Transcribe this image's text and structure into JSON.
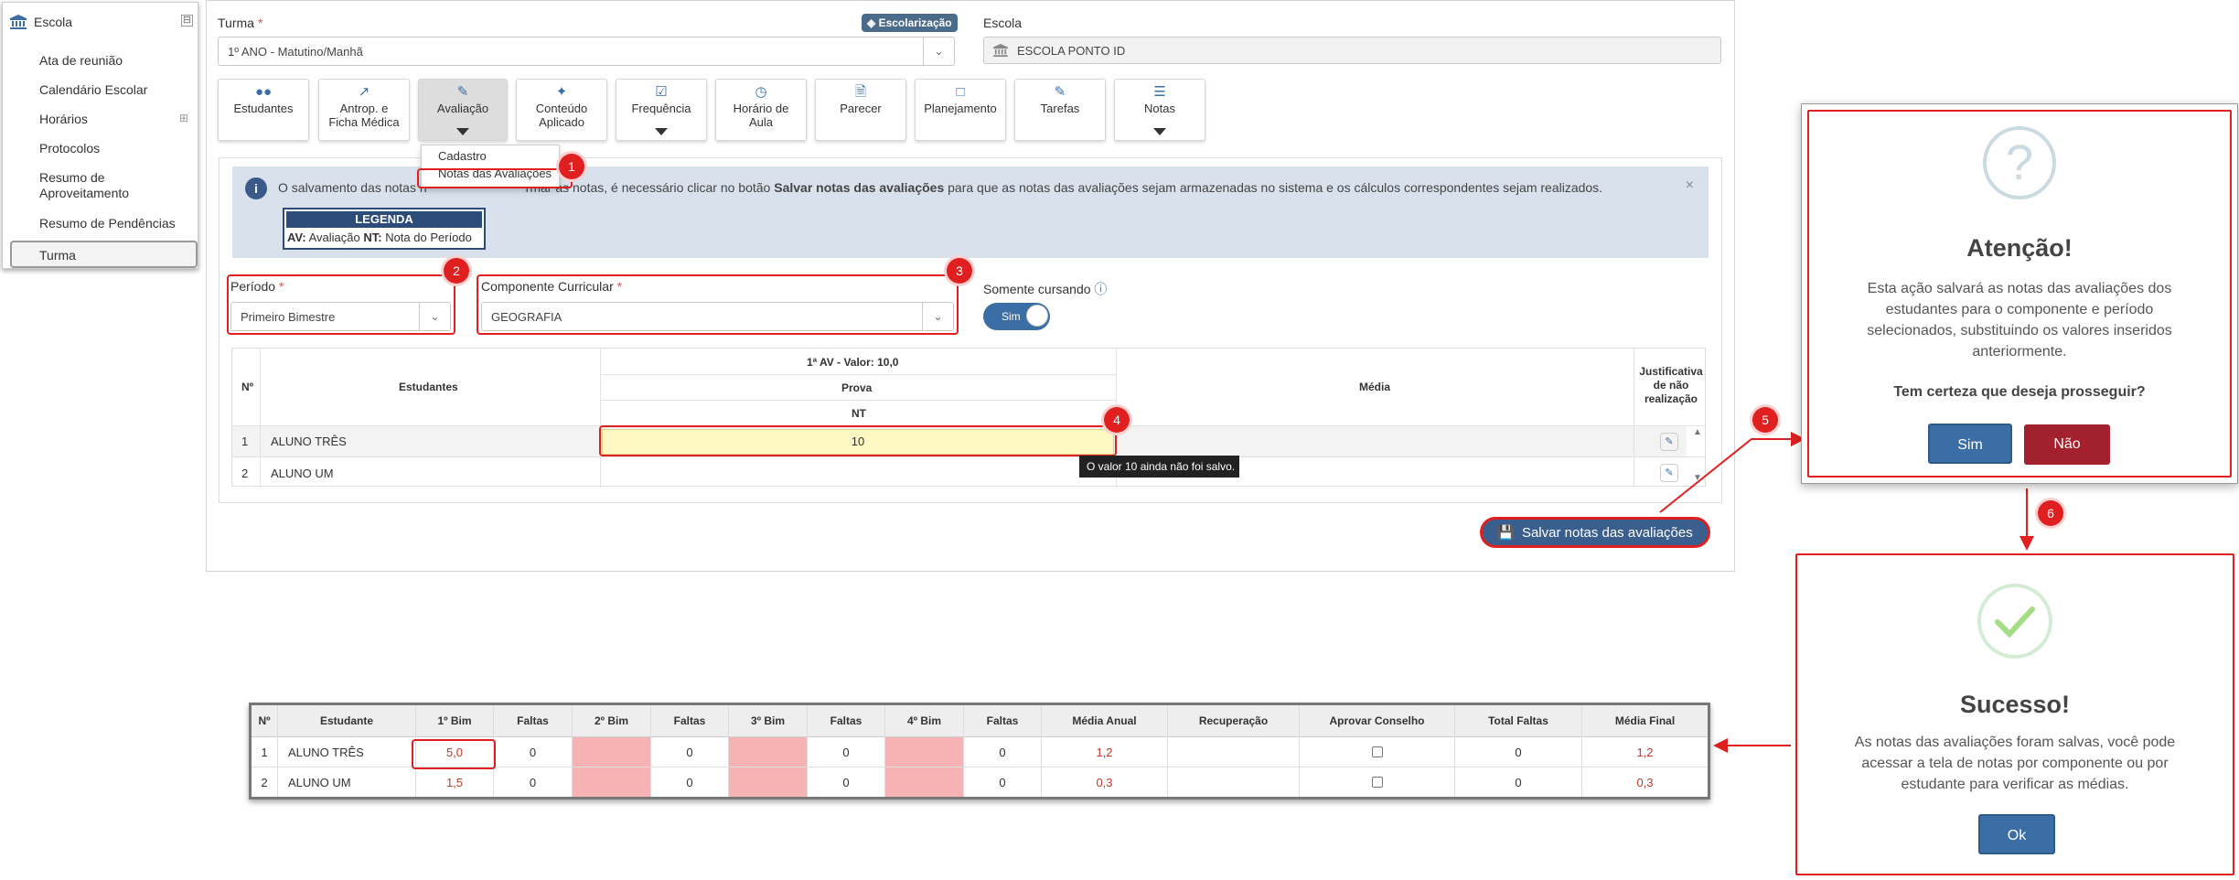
{
  "sidebar": {
    "title": "Escola",
    "collapse": "⊟",
    "items": [
      {
        "label": "Ata de reunião"
      },
      {
        "label": "Calendário Escolar"
      },
      {
        "label": "Horários"
      },
      {
        "label": "Protocolos"
      },
      {
        "label": "Resumo de"
      },
      {
        "label": "Aproveitamento"
      },
      {
        "label": "Resumo de Pendências"
      },
      {
        "label": "Turma"
      }
    ],
    "horarios_expand": "⊞"
  },
  "form": {
    "turma_label": "Turma",
    "required_mark": "*",
    "turma_value": "1º ANO - Matutino/Manhã",
    "badge": "Escolarização",
    "escola_label": "Escola",
    "escola_value": "ESCOLA PONTO ID"
  },
  "nav": {
    "estudantes": "Estudantes",
    "antrop1": "Antrop. e",
    "antrop2": "Ficha Médica",
    "avaliacao": "Avaliação",
    "conteudo1": "Conteúdo",
    "conteudo2": "Aplicado",
    "frequencia": "Frequência",
    "horario1": "Horário de",
    "horario2": "Aula",
    "parecer": "Parecer",
    "planejamento": "Planejamento",
    "tarefas": "Tarefas",
    "notas": "Notas"
  },
  "aval_menu": {
    "cadastro": "Cadastro",
    "notas": "Notas das Avaliações"
  },
  "alert": {
    "text_a": "O salvamento das notas n",
    "text_b": "rmar as notas, é necessário clicar no botão ",
    "text_bold": "Salvar notas das avaliações",
    "text_c": " para que as notas das avaliações sejam armazenadas no sistema e os cálculos correspondentes sejam realizados.",
    "close": "×",
    "info": "i"
  },
  "legend": {
    "title": "LEGENDA",
    "av_abbr": "AV:",
    "av_text": " Avaliação  ",
    "nt_abbr": "NT:",
    "nt_text": " Nota do Período"
  },
  "filters": {
    "periodo_label": "Período",
    "periodo_value": "Primeiro Bimestre",
    "componente_label": "Componente Curricular",
    "componente_value": "GEOGRAFIA",
    "somente_label": "Somente cursando",
    "toggle": "Sim"
  },
  "grades": {
    "h_num": "Nº",
    "h_estudantes": "Estudantes",
    "h_av": "1ª AV - Valor: 10,0",
    "h_prova": "Prova",
    "h_nt": "NT",
    "h_media": "Média",
    "h_just1": "Justificativa",
    "h_just2": "de não",
    "h_just3": "realização",
    "rows": [
      {
        "n": "1",
        "name": "ALUNO TRÊS",
        "value": "10"
      },
      {
        "n": "2",
        "name": "ALUNO UM",
        "value": ""
      }
    ],
    "tooltip": "O valor 10 ainda não foi salvo."
  },
  "save_button": "Salvar notas das avaliações",
  "steps": [
    "1",
    "2",
    "3",
    "4",
    "5",
    "6",
    "i"
  ],
  "confirm": {
    "icon": "?",
    "title": "Atenção!",
    "line1": "Esta ação salvará as notas das avaliações dos",
    "line2": "estudantes para o componente e período",
    "line3": "selecionados, substituindo os valores inseridos",
    "line4": "anteriormente.",
    "question": "Tem certeza que deseja prosseguir?",
    "yes": "Sim",
    "no": "Não"
  },
  "success": {
    "title": "Sucesso!",
    "line1": "As notas das avaliações foram salvas, você pode",
    "line2": "acessar a tela de notas por componente ou por",
    "line3": "estudante para verificar as médias.",
    "ok": "Ok"
  },
  "final_table": {
    "headers": [
      "Nº",
      "Estudante",
      "1º Bim",
      "Faltas",
      "2º Bim",
      "Faltas",
      "3º Bim",
      "Faltas",
      "4º Bim",
      "Faltas",
      "Média Anual",
      "Recuperação",
      "Aprovar Conselho",
      "Total Faltas",
      "Média Final"
    ],
    "rows": [
      {
        "n": "1",
        "name": "ALUNO TRÊS",
        "b1": "5,0",
        "f1": "0",
        "f2": "0",
        "f3": "0",
        "f4": "0",
        "ma": "1,2",
        "tf": "0",
        "mf": "1,2"
      },
      {
        "n": "2",
        "name": "ALUNO UM",
        "b1": "1,5",
        "f1": "0",
        "f2": "0",
        "f3": "0",
        "f4": "0",
        "ma": "0,3",
        "tf": "0",
        "mf": "0,3"
      }
    ]
  },
  "colors": {
    "accent": "#3a6ea5",
    "annotation": "#e02020",
    "danger": "#a3202e"
  }
}
